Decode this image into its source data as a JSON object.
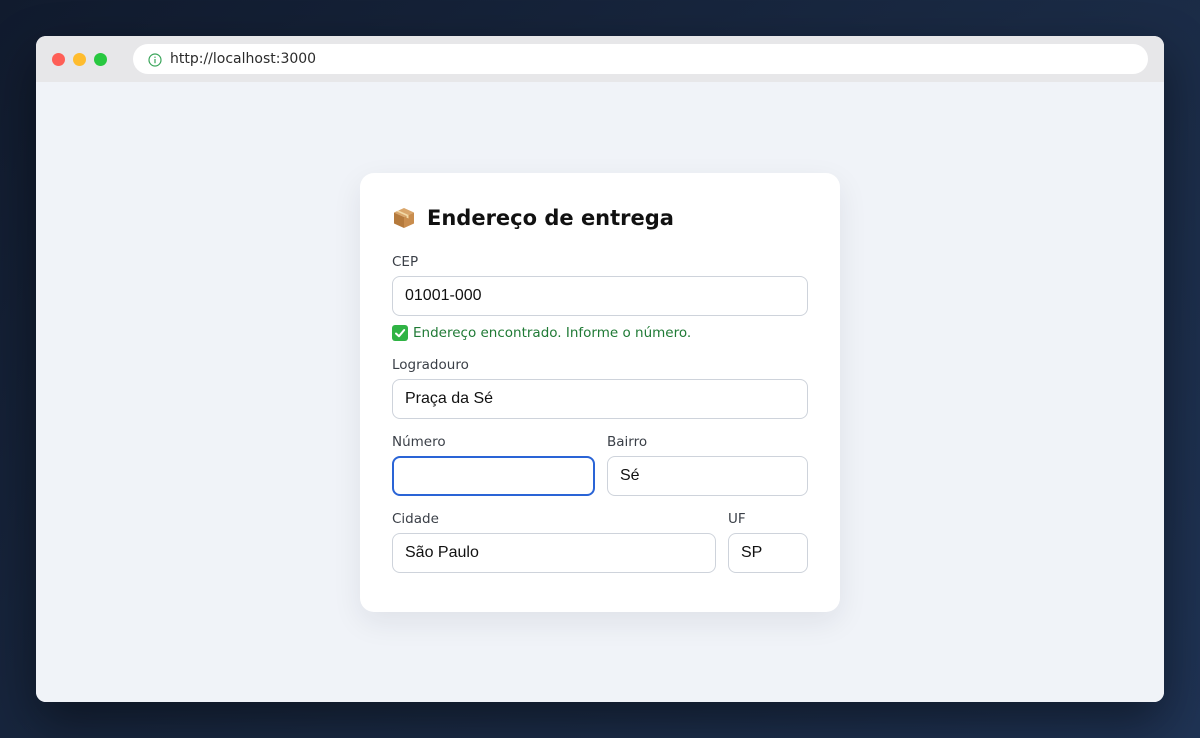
{
  "browser": {
    "url": "http://localhost:3000"
  },
  "form": {
    "title": "Endereço de entrega",
    "title_icon": "package-icon",
    "cep": {
      "label": "CEP",
      "value": "01001-000"
    },
    "status_message": "Endereço encontrado. Informe o número.",
    "status_color": "#1f7a35",
    "logradouro": {
      "label": "Logradouro",
      "value": "Praça da Sé"
    },
    "numero": {
      "label": "Número",
      "value": ""
    },
    "bairro": {
      "label": "Bairro",
      "value": "Sé"
    },
    "cidade": {
      "label": "Cidade",
      "value": "São Paulo"
    },
    "uf": {
      "label": "UF",
      "value": "SP"
    },
    "focus_color": "#2a64d6"
  }
}
